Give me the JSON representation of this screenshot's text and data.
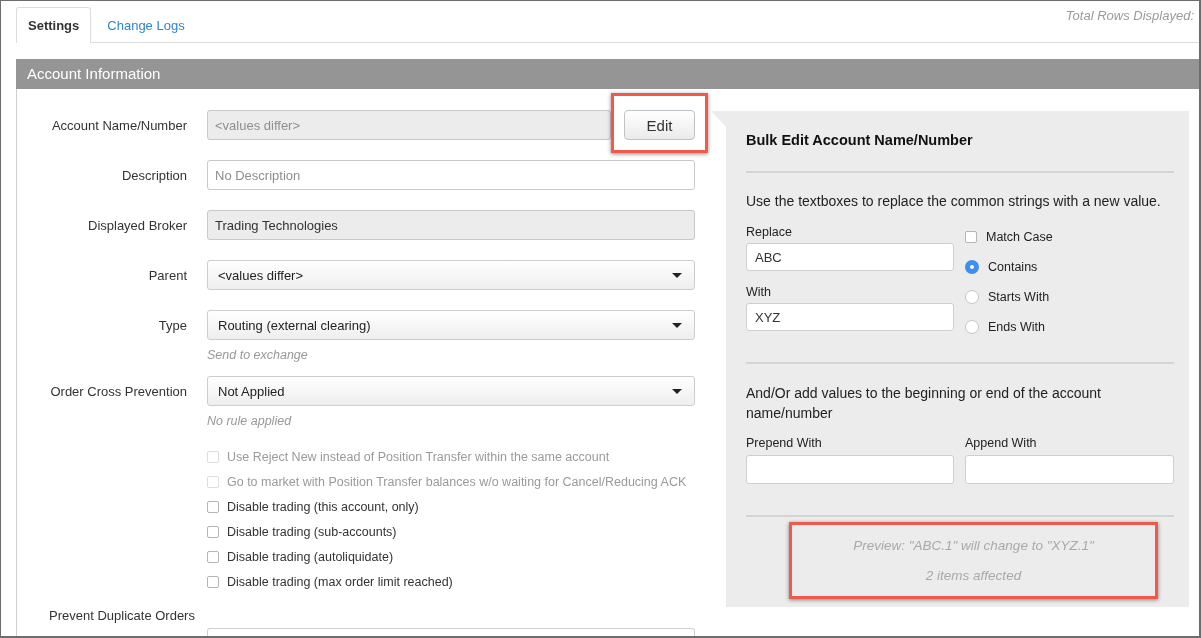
{
  "tabs": [
    {
      "label": "Settings",
      "selected": true
    },
    {
      "label": "Change Logs",
      "selected": false
    }
  ],
  "total_rows": "Total Rows Displayed:",
  "section": {
    "title": "Account Information"
  },
  "form": {
    "fields": [
      {
        "kind": "text",
        "label": "Account Name/Number",
        "placeholder": "<values differ>",
        "disabled": true,
        "button": {
          "label": "Edit",
          "highlighted": true
        }
      },
      {
        "kind": "text",
        "label": "Description",
        "placeholder": "No Description",
        "disabled": false
      },
      {
        "kind": "text",
        "label": "Displayed Broker",
        "value": "Trading Technologies",
        "disabled": true
      },
      {
        "kind": "select",
        "label": "Parent",
        "value": "<values differ>"
      },
      {
        "kind": "select",
        "label": "Type",
        "value": "Routing (external clearing)",
        "hint": "Send to exchange"
      },
      {
        "kind": "select",
        "label": "Order Cross Prevention",
        "value": "Not Applied",
        "hint": "No rule applied"
      }
    ],
    "checkboxes": [
      {
        "label": "Use Reject New instead of Position Transfer within the same account",
        "checked": false,
        "disabled": true
      },
      {
        "label": "Go to market with Position Transfer balances w/o waiting for Cancel/Reducing ACK",
        "checked": false,
        "disabled": true
      },
      {
        "label": "Disable trading (this account, only)",
        "checked": false,
        "disabled": false
      },
      {
        "label": "Disable trading (sub-accounts)",
        "checked": false,
        "disabled": false
      },
      {
        "label": "Disable trading (autoliquidate)",
        "checked": false,
        "disabled": false
      },
      {
        "label": "Disable trading (max order limit reached)",
        "checked": false,
        "disabled": false
      }
    ],
    "subheading": "Prevent Duplicate Orders"
  },
  "bulk_edit": {
    "title": "Bulk Edit Account Name/Number",
    "instructions": "Use the textboxes to replace the common strings with a new value.",
    "replace": {
      "label": "Replace",
      "value": "ABC"
    },
    "with": {
      "label": "With",
      "value": "XYZ"
    },
    "match_case": {
      "label": "Match Case",
      "checked": false
    },
    "match_modes": [
      {
        "label": "Contains",
        "selected": true
      },
      {
        "label": "Starts With",
        "selected": false
      },
      {
        "label": "Ends With",
        "selected": false
      }
    ],
    "affix_instructions": "And/Or add values to the beginning or end of the account name/number",
    "prepend": {
      "label": "Prepend With"
    },
    "append": {
      "label": "Append With"
    },
    "preview": {
      "highlighted": true,
      "lines": [
        "Preview: \"ABC.1\" will change to \"XYZ.1\"",
        "2 items affected"
      ]
    }
  }
}
